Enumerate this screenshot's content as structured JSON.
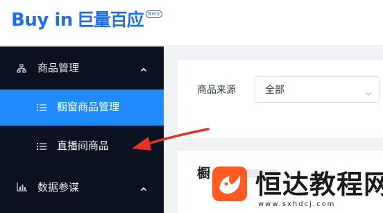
{
  "brand": {
    "name_en": "Buy in",
    "name_cn": "巨量百应",
    "badge": "Beta"
  },
  "colors": {
    "brand_blue": "#1f6fe5",
    "sidebar_bg": "#0b1120",
    "active_item_bg": "#1f8bff",
    "annotation_red": "#e6312a",
    "watermark_orange": "#ff5a1f"
  },
  "sidebar": {
    "groups": [
      {
        "icon": "sitemap-icon",
        "label": "商品管理",
        "caret": "chevron-up-icon",
        "items": [
          {
            "icon": "list-icon",
            "label": "橱窗商品管理",
            "active": true
          },
          {
            "icon": "list-icon",
            "label": "直播间商品",
            "active": false
          }
        ]
      },
      {
        "icon": "bar-chart-icon",
        "label": "数据参谋",
        "caret": "chevron-up-icon",
        "items": []
      }
    ]
  },
  "main": {
    "filter": {
      "label": "商品来源",
      "value": "全部",
      "caret": "chevron-down-icon"
    },
    "section": {
      "title": "橱"
    }
  },
  "watermark": {
    "text": "恒达教程网",
    "url": "www.sxhdcj.com"
  }
}
